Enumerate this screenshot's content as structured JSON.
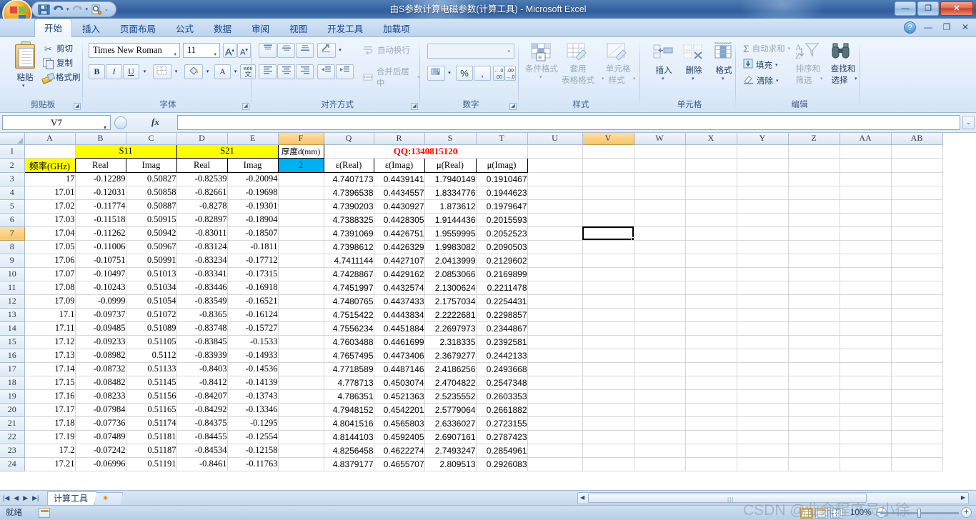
{
  "window": {
    "title": "由S参数计算电磁参数(计算工具) - Microsoft Excel",
    "minimize": "—",
    "maximize": "❐",
    "close": "✕"
  },
  "quick_access": {
    "save_icon": "save-icon",
    "undo_icon": "undo-icon",
    "redo_icon": "redo-icon",
    "print_preview_icon": "print-preview-icon",
    "customize_icon": "customize-qat-icon"
  },
  "ribbon": {
    "tabs": [
      {
        "label": "开始",
        "active": true
      },
      {
        "label": "插入",
        "active": false
      },
      {
        "label": "页面布局",
        "active": false
      },
      {
        "label": "公式",
        "active": false
      },
      {
        "label": "数据",
        "active": false
      },
      {
        "label": "审阅",
        "active": false
      },
      {
        "label": "视图",
        "active": false
      },
      {
        "label": "开发工具",
        "active": false
      },
      {
        "label": "加载项",
        "active": false
      }
    ],
    "help": "?",
    "win_minimize": "—",
    "win_restore": "❐",
    "win_close": "✕",
    "groups": {
      "clipboard": {
        "label": "剪贴板",
        "paste": "粘贴",
        "cut": "剪切",
        "copy": "复制",
        "format_painter": "格式刷"
      },
      "font": {
        "label": "字体",
        "font_name": "Times New Roman",
        "font_size": "11",
        "grow_font": "A",
        "shrink_font": "A",
        "bold": "B",
        "italic": "I",
        "underline": "U",
        "border": "田",
        "fill_color": "A",
        "font_color": "A",
        "phonetic": "文"
      },
      "alignment": {
        "label": "对齐方式",
        "wrap_text": "自动换行",
        "merge_center": "合并后居中",
        "orientation": "方向"
      },
      "number": {
        "label": "数字",
        "format_value": "",
        "accounting": "￥",
        "percent": "%",
        "comma": ",",
        "increase_decimal": ".00",
        "decrease_decimal": ".00"
      },
      "styles": {
        "label": "样式",
        "conditional": "条件格式",
        "table_format_1": "套用",
        "table_format_2": "表格格式",
        "cell_style_1": "单元格",
        "cell_style_2": "样式"
      },
      "cells": {
        "label": "单元格",
        "insert": "插入",
        "delete": "删除",
        "format": "格式"
      },
      "editing": {
        "label": "编辑",
        "autosum": "自动求和",
        "fill": "填充",
        "clear": "清除",
        "sort_filter_1": "排序和",
        "sort_filter_2": "筛选",
        "find_select_1": "查找和",
        "find_select_2": "选择"
      }
    }
  },
  "formula_bar": {
    "name_box": "V7",
    "fx_label": "fx",
    "formula_value": ""
  },
  "grid": {
    "selected_cell": "V7",
    "columns": [
      "A",
      "B",
      "C",
      "D",
      "E",
      "F",
      "Q",
      "R",
      "S",
      "T",
      "U",
      "V",
      "W",
      "X",
      "Y",
      "Z",
      "AA",
      "AB"
    ],
    "selected_column": "V",
    "selected_row": 7,
    "row_numbers": [
      1,
      2,
      3,
      4,
      5,
      6,
      7,
      8,
      9,
      10,
      11,
      12,
      13,
      14,
      15,
      16,
      17,
      18,
      19,
      20,
      21,
      22,
      23,
      24
    ],
    "header_row1": {
      "s11": "S11",
      "s21": "S21",
      "thickness": "厚度d(mm)",
      "qq_note": "QQ:1340815120"
    },
    "header_row2": {
      "freq": "频率(GHz)",
      "s11_real": "Real",
      "s11_imag": "Imag",
      "s21_real": "Real",
      "s21_imag": "Imag",
      "thickness_value": "2",
      "eps_real": "ε(Real)",
      "eps_imag": "ε(Imag)",
      "mu_real": "μ(Real)",
      "mu_imag": "μ(Imag)"
    },
    "rows": [
      {
        "r": 3,
        "A": "17",
        "B": "-0.12289",
        "C": "0.50827",
        "D": "-0.82539",
        "E": "-0.20094",
        "Q": "4.7407173",
        "R": "0.4439141",
        "S": "1.7940149",
        "T": "0.1910467"
      },
      {
        "r": 4,
        "A": "17.01",
        "B": "-0.12031",
        "C": "0.50858",
        "D": "-0.82661",
        "E": "-0.19698",
        "Q": "4.7396538",
        "R": "0.4434557",
        "S": "1.8334776",
        "T": "0.1944623"
      },
      {
        "r": 5,
        "A": "17.02",
        "B": "-0.11774",
        "C": "0.50887",
        "D": "-0.8278",
        "E": "-0.19301",
        "Q": "4.7390203",
        "R": "0.4430927",
        "S": "1.873612",
        "T": "0.1979647"
      },
      {
        "r": 6,
        "A": "17.03",
        "B": "-0.11518",
        "C": "0.50915",
        "D": "-0.82897",
        "E": "-0.18904",
        "Q": "4.7388325",
        "R": "0.4428305",
        "S": "1.9144436",
        "T": "0.2015593"
      },
      {
        "r": 7,
        "A": "17.04",
        "B": "-0.11262",
        "C": "0.50942",
        "D": "-0.83011",
        "E": "-0.18507",
        "Q": "4.7391069",
        "R": "0.4426751",
        "S": "1.9559995",
        "T": "0.2052523"
      },
      {
        "r": 8,
        "A": "17.05",
        "B": "-0.11006",
        "C": "0.50967",
        "D": "-0.83124",
        "E": "-0.1811",
        "Q": "4.7398612",
        "R": "0.4426329",
        "S": "1.9983082",
        "T": "0.2090503"
      },
      {
        "r": 9,
        "A": "17.06",
        "B": "-0.10751",
        "C": "0.50991",
        "D": "-0.83234",
        "E": "-0.17712",
        "Q": "4.7411144",
        "R": "0.4427107",
        "S": "2.0413999",
        "T": "0.2129602"
      },
      {
        "r": 10,
        "A": "17.07",
        "B": "-0.10497",
        "C": "0.51013",
        "D": "-0.83341",
        "E": "-0.17315",
        "Q": "4.7428867",
        "R": "0.4429162",
        "S": "2.0853066",
        "T": "0.2169899"
      },
      {
        "r": 11,
        "A": "17.08",
        "B": "-0.10243",
        "C": "0.51034",
        "D": "-0.83446",
        "E": "-0.16918",
        "Q": "4.7451997",
        "R": "0.4432574",
        "S": "2.1300624",
        "T": "0.2211478"
      },
      {
        "r": 12,
        "A": "17.09",
        "B": "-0.0999",
        "C": "0.51054",
        "D": "-0.83549",
        "E": "-0.16521",
        "Q": "4.7480765",
        "R": "0.4437433",
        "S": "2.1757034",
        "T": "0.2254431"
      },
      {
        "r": 13,
        "A": "17.1",
        "B": "-0.09737",
        "C": "0.51072",
        "D": "-0.8365",
        "E": "-0.16124",
        "Q": "4.7515422",
        "R": "0.4443834",
        "S": "2.2222681",
        "T": "0.2298857"
      },
      {
        "r": 14,
        "A": "17.11",
        "B": "-0.09485",
        "C": "0.51089",
        "D": "-0.83748",
        "E": "-0.15727",
        "Q": "4.7556234",
        "R": "0.4451884",
        "S": "2.2697973",
        "T": "0.2344867"
      },
      {
        "r": 15,
        "A": "17.12",
        "B": "-0.09233",
        "C": "0.51105",
        "D": "-0.83845",
        "E": "-0.1533",
        "Q": "4.7603488",
        "R": "0.4461699",
        "S": "2.318335",
        "T": "0.2392581"
      },
      {
        "r": 16,
        "A": "17.13",
        "B": "-0.08982",
        "C": "0.5112",
        "D": "-0.83939",
        "E": "-0.14933",
        "Q": "4.7657495",
        "R": "0.4473406",
        "S": "2.3679277",
        "T": "0.2442133"
      },
      {
        "r": 17,
        "A": "17.14",
        "B": "-0.08732",
        "C": "0.51133",
        "D": "-0.8403",
        "E": "-0.14536",
        "Q": "4.7718589",
        "R": "0.4487146",
        "S": "2.4186256",
        "T": "0.2493668"
      },
      {
        "r": 18,
        "A": "17.15",
        "B": "-0.08482",
        "C": "0.51145",
        "D": "-0.8412",
        "E": "-0.14139",
        "Q": "4.778713",
        "R": "0.4503074",
        "S": "2.4704822",
        "T": "0.2547348"
      },
      {
        "r": 19,
        "A": "17.16",
        "B": "-0.08233",
        "C": "0.51156",
        "D": "-0.84207",
        "E": "-0.13743",
        "Q": "4.786351",
        "R": "0.4521363",
        "S": "2.5235552",
        "T": "0.2603353"
      },
      {
        "r": 20,
        "A": "17.17",
        "B": "-0.07984",
        "C": "0.51165",
        "D": "-0.84292",
        "E": "-0.13346",
        "Q": "4.7948152",
        "R": "0.4542201",
        "S": "2.5779064",
        "T": "0.2661882"
      },
      {
        "r": 21,
        "A": "17.18",
        "B": "-0.07736",
        "C": "0.51174",
        "D": "-0.84375",
        "E": "-0.1295",
        "Q": "4.8041516",
        "R": "0.4565803",
        "S": "2.6336027",
        "T": "0.2723155"
      },
      {
        "r": 22,
        "A": "17.19",
        "B": "-0.07489",
        "C": "0.51181",
        "D": "-0.84455",
        "E": "-0.12554",
        "Q": "4.8144103",
        "R": "0.4592405",
        "S": "2.6907161",
        "T": "0.2787423"
      },
      {
        "r": 23,
        "A": "17.2",
        "B": "-0.07242",
        "C": "0.51187",
        "D": "-0.84534",
        "E": "-0.12158",
        "Q": "4.8256458",
        "R": "0.4622274",
        "S": "2.7493247",
        "T": "0.2854961"
      },
      {
        "r": 24,
        "A": "17.21",
        "B": "-0.06996",
        "C": "0.51191",
        "D": "-0.8461",
        "E": "-0.11763",
        "Q": "4.8379177",
        "R": "0.4655707",
        "S": "2.809513",
        "T": "0.2926083"
      }
    ]
  },
  "sheet_tabs": {
    "first": "|◀",
    "prev": "◀",
    "next": "▶",
    "last": "▶|",
    "active_sheet": "计算工具",
    "new_sheet_icon": "new-sheet-icon"
  },
  "status_bar": {
    "ready": "就绪",
    "zoom": "100%",
    "zoom_out": "—",
    "zoom_in": "+",
    "view_normal": "normal-view-icon",
    "view_layout": "page-layout-icon",
    "view_break": "page-break-icon"
  },
  "watermark": "CSDN @业余程序员小徐",
  "colors": {
    "yellow_header": "#ffff00",
    "cyan_cell": "#00b0f0",
    "red_note": "#ff0000",
    "selected_header": "#f7c46a"
  }
}
